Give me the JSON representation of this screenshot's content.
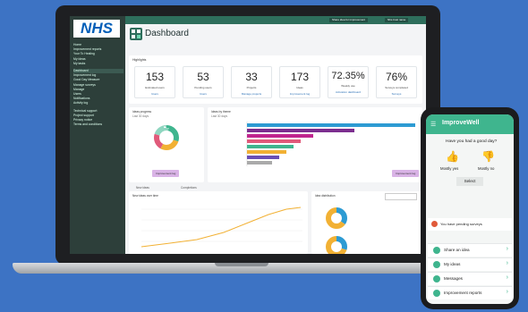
{
  "brand": {
    "logo": "NHS"
  },
  "topbar": {
    "btn1": "Share idea for improvement",
    "btn2": "Nhs trust name"
  },
  "sidebar": {
    "items": [
      "Home",
      "Improvement reports",
      "Your To Healing",
      "My ideas",
      "My tasks",
      "Dashboard",
      "Improvement log",
      "Good Day Measure",
      "Manage surveys",
      "Manage",
      "Users",
      "Notifications",
      "Activity log",
      "Technical support",
      "Project support",
      "Privacy notice",
      "Terms and conditions"
    ]
  },
  "dashboard": {
    "title": "Dashboard",
    "highlights_label": "Highlights"
  },
  "stats": [
    {
      "num": "153",
      "label": "Estimated users",
      "link": "Users"
    },
    {
      "num": "53",
      "label": "Pending users",
      "link": "Users"
    },
    {
      "num": "33",
      "label": "Projects",
      "link": "Manage projects"
    },
    {
      "num": "173",
      "label": "Ideas",
      "link": "Improvement log"
    },
    {
      "num": "72.35%",
      "label": "Weekly use",
      "link": "Activation dashboard"
    },
    {
      "num": "76%",
      "label": "Surveys completed",
      "link": "Surveys"
    }
  ],
  "panels": {
    "ideas_progress": "Ideas progress",
    "ideas_progress_sub": "Last 30 days",
    "ideas_by_theme": "Ideas by theme",
    "ideas_by_theme_sub": "Last 30 days",
    "ideas_over_time": "New ideas over time",
    "ideas_distribution": "Idea distribution",
    "improvement_log_btn": "Improvement log",
    "tab1": "New ideas",
    "tab2": "Completions"
  },
  "phone": {
    "app_title": "ImproveWell",
    "question": "Have you had a good day?",
    "yes": "Mostly yes",
    "no": "Mostly no",
    "select": "Select",
    "notice": "You have pending surveys",
    "items": [
      "Share an idea",
      "My ideas",
      "Messages",
      "Improvement reports"
    ]
  },
  "colors": {
    "accent": "#3fb58e",
    "sidebar": "#2d3f3a",
    "bg": "#3d73c4"
  }
}
